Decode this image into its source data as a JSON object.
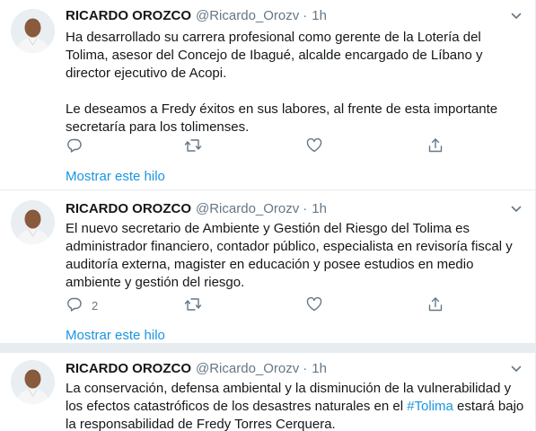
{
  "tweets": [
    {
      "name": "RICARDO OROZCO",
      "handle": "@Ricardo_Orozv",
      "separator": "·",
      "time": "1h",
      "paragraph1": "Ha desarrollado su carrera profesional como gerente de la Lotería del Tolima, asesor del Concejo de Ibagué, alcalde encargado de Líbano y director ejecutivo de Acopi.",
      "paragraph2": "Le deseamos a Fredy éxitos en sus labores, al frente de esta importante secretaría para los tolimenses.",
      "reply_count": "",
      "show_thread": "Mostrar este hilo"
    },
    {
      "name": "RICARDO OROZCO",
      "handle": "@Ricardo_Orozv",
      "separator": "·",
      "time": "1h",
      "paragraph1": "El nuevo secretario de Ambiente y Gestión del Riesgo del Tolima es administrador financiero, contador público, especialista en revisoría fiscal y auditoría externa, magister en educación y posee estudios en medio ambiente y gestión del riesgo.",
      "reply_count": "2",
      "show_thread": "Mostrar este hilo"
    },
    {
      "name": "RICARDO OROZCO",
      "handle": "@Ricardo_Orozv",
      "separator": "·",
      "time": "1h",
      "text_before": "La conservación, defensa ambiental y la disminución de la vulnerabilidad y los efectos catastróficos de los desastres naturales en el ",
      "hashtag": "#Tolima",
      "text_after": " estará bajo la responsabilidad de Fredy Torres Cerquera."
    }
  ],
  "icons": {
    "avatar": "avatar",
    "more": "chevron-down-icon",
    "reply": "reply-icon",
    "retweet": "retweet-icon",
    "like": "heart-icon",
    "share": "share-icon"
  },
  "colors": {
    "accent": "#1b95e0",
    "muted": "#657786",
    "text": "#14171a",
    "border": "#e6ecf0"
  }
}
